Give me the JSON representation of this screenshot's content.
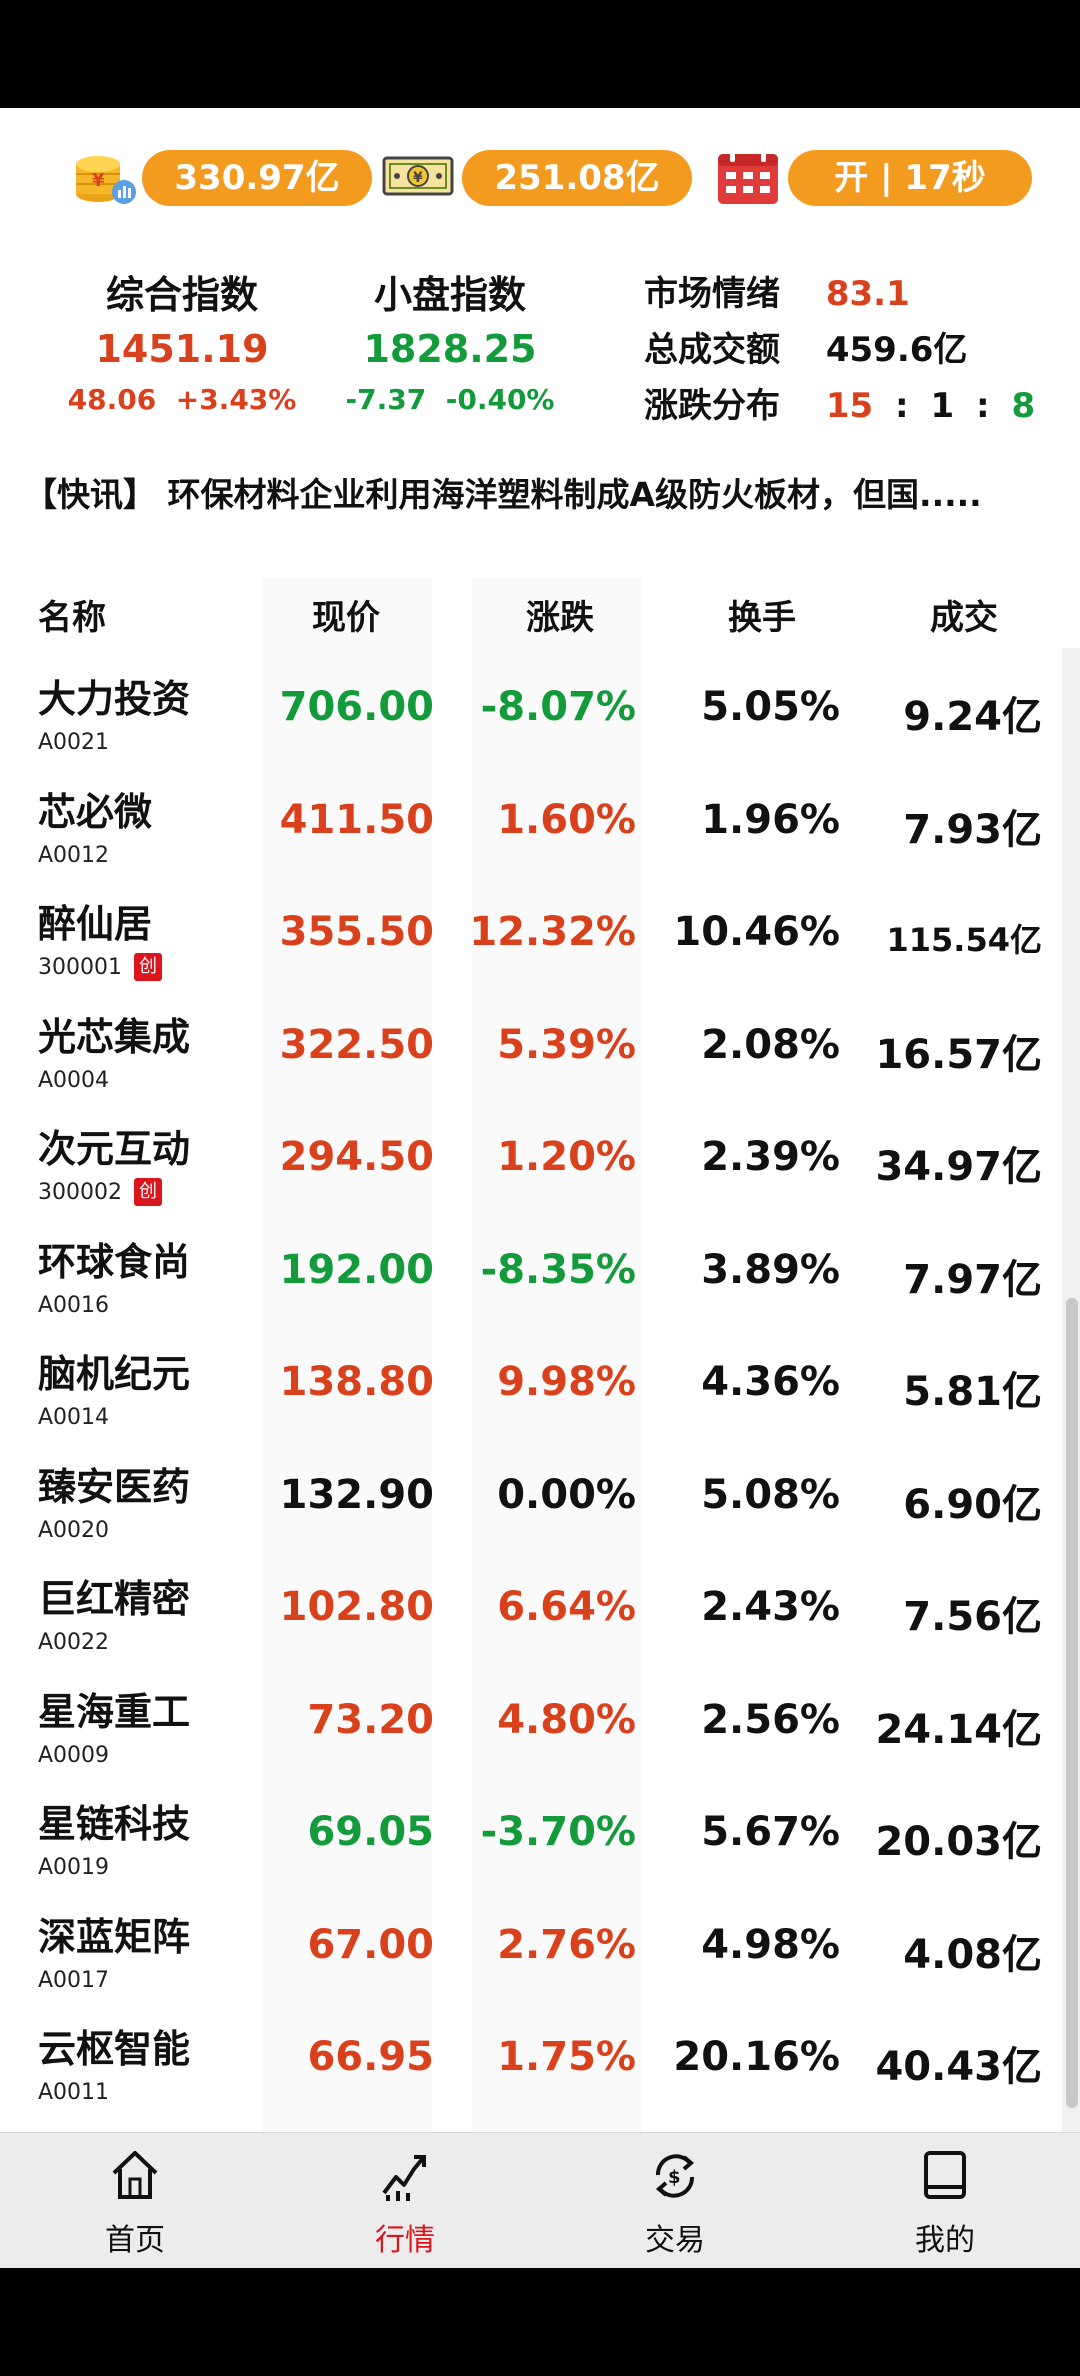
{
  "top_bar": {
    "pill1": {
      "icon": "coin-stack-icon",
      "value": "330.97亿"
    },
    "pill2": {
      "icon": "money-bill-icon",
      "value": "251.08亿"
    },
    "pill3": {
      "icon": "calendar-icon",
      "value": "开 | 17秒"
    }
  },
  "indices": [
    {
      "name": "综合指数",
      "value": "1451.19",
      "change": "48.06",
      "percent": "+3.43%",
      "trend": "up"
    },
    {
      "name": "小盘指数",
      "value": "1828.25",
      "change": "-7.37",
      "percent": "-0.40%",
      "trend": "down"
    }
  ],
  "market": {
    "sentiment_label": "市场情绪",
    "sentiment_value": "83.1",
    "volume_label": "总成交额",
    "volume_value": "459.6亿",
    "dist_label": "涨跌分布",
    "dist_up": "15",
    "dist_flat": "1",
    "dist_down": "8",
    "sep": ":"
  },
  "news": "【快讯】 环保材料企业利用海洋塑料制成A级防火板材，但国.....",
  "table": {
    "headers": {
      "name": "名称",
      "price": "现价",
      "change": "涨跌",
      "turnover": "换手",
      "volume": "成交"
    },
    "rows": [
      {
        "name": "大力投资",
        "code": "A0021",
        "price": "706.00",
        "change": "-8.07%",
        "turnover": "5.05%",
        "volume": "9.24亿",
        "trend": "down"
      },
      {
        "name": "芯必微",
        "code": "A0012",
        "price": "411.50",
        "change": "1.60%",
        "turnover": "1.96%",
        "volume": "7.93亿",
        "trend": "up"
      },
      {
        "name": "醉仙居",
        "code": "300001",
        "badge": "创",
        "price": "355.50",
        "change": "12.32%",
        "turnover": "10.46%",
        "volume": "115.54亿",
        "trend": "up",
        "highlight": true
      },
      {
        "name": "光芯集成",
        "code": "A0004",
        "price": "322.50",
        "change": "5.39%",
        "turnover": "2.08%",
        "volume": "16.57亿",
        "trend": "up"
      },
      {
        "name": "次元互动",
        "code": "300002",
        "badge": "创",
        "price": "294.50",
        "change": "1.20%",
        "turnover": "2.39%",
        "volume": "34.97亿",
        "trend": "up"
      },
      {
        "name": "环球食尚",
        "code": "A0016",
        "price": "192.00",
        "change": "-8.35%",
        "turnover": "3.89%",
        "volume": "7.97亿",
        "trend": "down"
      },
      {
        "name": "脑机纪元",
        "code": "A0014",
        "price": "138.80",
        "change": "9.98%",
        "turnover": "4.36%",
        "volume": "5.81亿",
        "trend": "up"
      },
      {
        "name": "臻安医药",
        "code": "A0020",
        "price": "132.90",
        "change": "0.00%",
        "turnover": "5.08%",
        "volume": "6.90亿",
        "trend": "flat"
      },
      {
        "name": "巨红精密",
        "code": "A0022",
        "price": "102.80",
        "change": "6.64%",
        "turnover": "2.43%",
        "volume": "7.56亿",
        "trend": "up"
      },
      {
        "name": "星海重工",
        "code": "A0009",
        "price": "73.20",
        "change": "4.80%",
        "turnover": "2.56%",
        "volume": "24.14亿",
        "trend": "up"
      },
      {
        "name": "星链科技",
        "code": "A0019",
        "price": "69.05",
        "change": "-3.70%",
        "turnover": "5.67%",
        "volume": "20.03亿",
        "trend": "down"
      },
      {
        "name": "深蓝矩阵",
        "code": "A0017",
        "price": "67.00",
        "change": "2.76%",
        "turnover": "4.98%",
        "volume": "4.08亿",
        "trend": "up"
      },
      {
        "name": "云枢智能",
        "code": "A0011",
        "price": "66.95",
        "change": "1.75%",
        "turnover": "20.16%",
        "volume": "40.43亿",
        "trend": "up",
        "highlight": true
      }
    ]
  },
  "nav": [
    {
      "label": "首页",
      "icon": "home-icon"
    },
    {
      "label": "行情",
      "icon": "trend-chart-icon",
      "active": true
    },
    {
      "label": "交易",
      "icon": "exchange-icon"
    },
    {
      "label": "我的",
      "icon": "book-icon"
    }
  ],
  "colors": {
    "up": "#d9401c",
    "down": "#139a3b",
    "flat": "#111111",
    "highlight": "#8b1a9c",
    "pill": "#f29b1f",
    "active": "#d9161c"
  }
}
